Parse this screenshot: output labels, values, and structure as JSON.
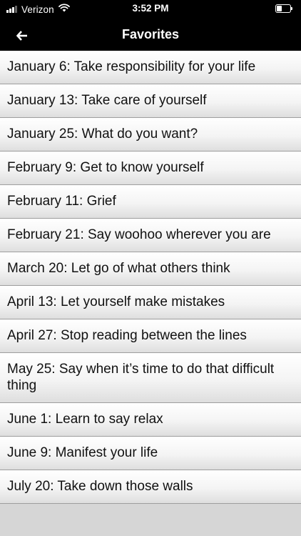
{
  "status_bar": {
    "carrier": "Verizon",
    "time": "3:52 PM",
    "signal_icon": "cellular-signal-icon",
    "wifi_icon": "wifi-icon",
    "battery_icon": "battery-icon"
  },
  "nav": {
    "title": "Favorites",
    "back_icon": "back-arrow-icon"
  },
  "favorites": [
    {
      "label": "January 6: Take responsibility for your life"
    },
    {
      "label": "January 13: Take care of yourself"
    },
    {
      "label": "January 25: What do you want?"
    },
    {
      "label": "February 9: Get to know yourself"
    },
    {
      "label": "February 11: Grief"
    },
    {
      "label": "February 21: Say woohoo wherever you are"
    },
    {
      "label": "March 20: Let go of what others think"
    },
    {
      "label": "April 13: Let yourself make mistakes"
    },
    {
      "label": "April 27: Stop reading between the lines"
    },
    {
      "label": "May 25: Say when it’s time to do that difficult thing"
    },
    {
      "label": "June 1: Learn to say relax"
    },
    {
      "label": "June 9: Manifest your life"
    },
    {
      "label": "July 20: Take down those walls"
    }
  ],
  "colors": {
    "bar_background": "#000000",
    "list_background": "#d6d6d6",
    "text": "#111111"
  }
}
